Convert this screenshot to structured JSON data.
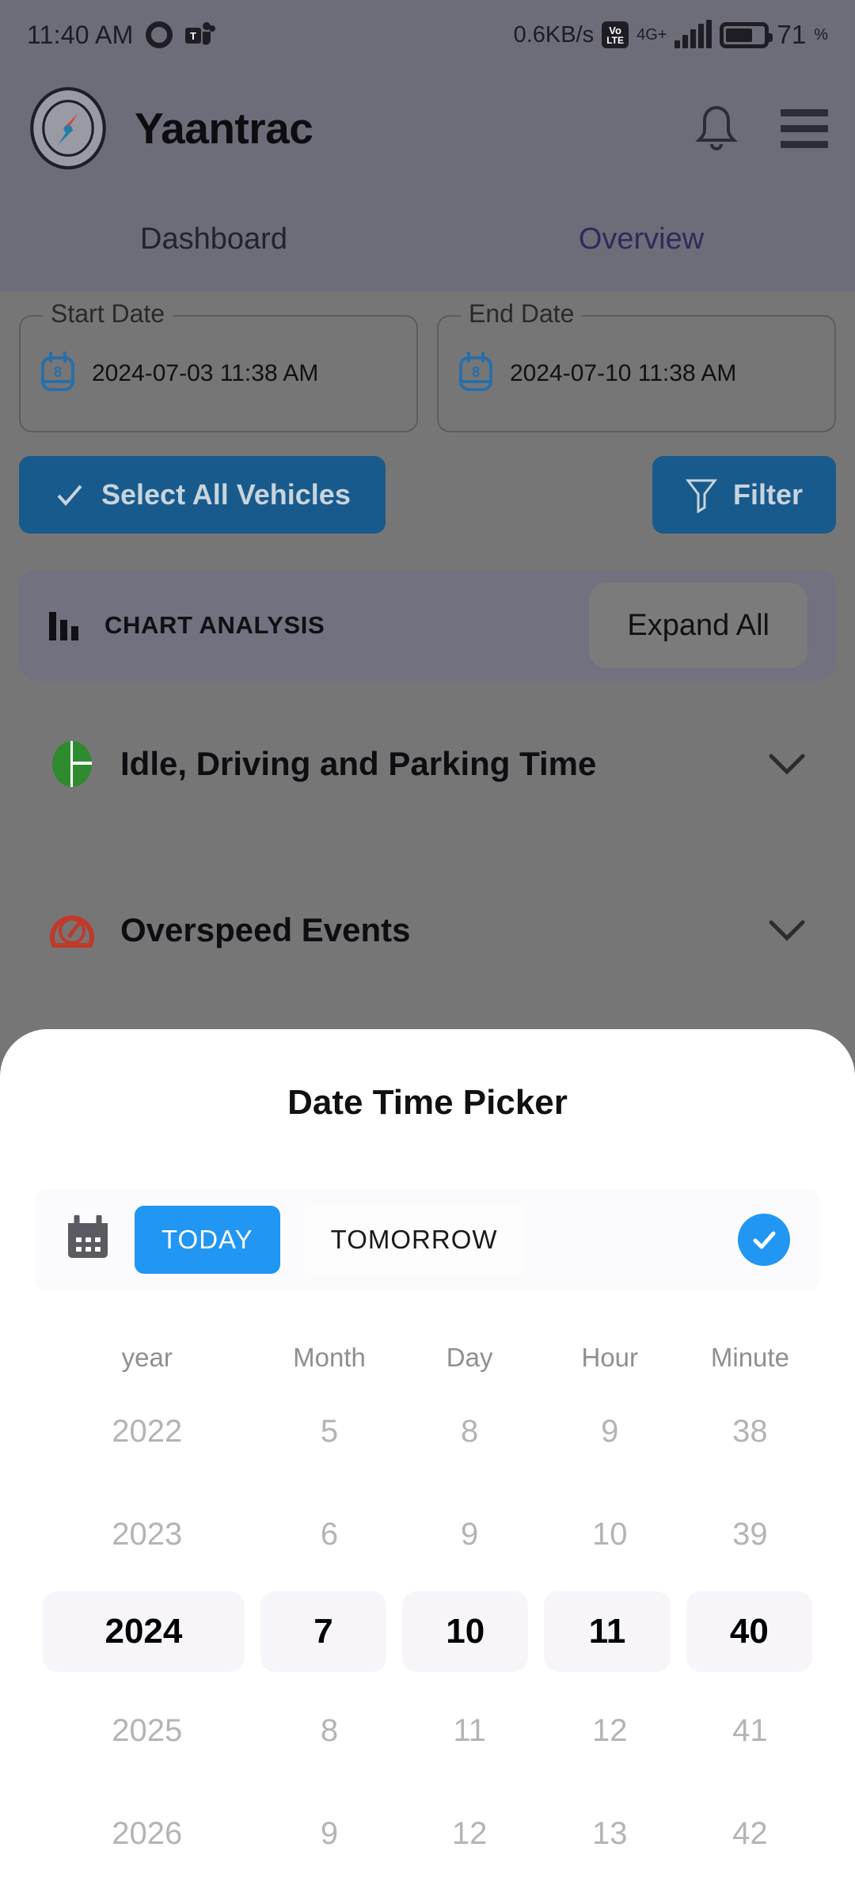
{
  "status_bar": {
    "time": "11:40 AM",
    "icons_left": [
      "screen-record-icon",
      "microsoft-teams-icon"
    ],
    "network_speed": "0.6KB/s",
    "volte_top": "Vo",
    "volte_bottom": "LTE",
    "network_generation": "4G+",
    "signal_icon": "signal-bars-icon",
    "battery_percent": "71",
    "battery_unit": "%"
  },
  "header": {
    "logo_icon": "compass-logo-icon",
    "app_title": "Yaantrac",
    "notification_icon": "bell-icon",
    "menu_icon": "hamburger-menu-icon"
  },
  "tabs": [
    {
      "label": "Dashboard",
      "active": false
    },
    {
      "label": "Overview",
      "active": true
    }
  ],
  "filters": {
    "start_date": {
      "legend": "Start Date",
      "value": "2024-07-03 11:38 AM",
      "icon": "calendar-icon"
    },
    "end_date": {
      "legend": "End Date",
      "value": "2024-07-10 11:38 AM",
      "icon": "calendar-icon"
    },
    "select_all_vehicles_label": "Select All Vehicles",
    "select_all_vehicles_icon": "check-icon",
    "filter_label": "Filter",
    "filter_icon": "funnel-icon"
  },
  "chart_analysis": {
    "icon": "bar-chart-icon",
    "label": "CHART ANALYSIS",
    "expand_all_label": "Expand All"
  },
  "accordions": [
    {
      "title": "Idle, Driving and Parking Time",
      "icon": "pie-chart-icon",
      "icon_color": "#2e8b2e",
      "chevron": "chevron-down-icon"
    },
    {
      "title": "Overspeed Events",
      "icon": "speedometer-icon",
      "icon_color": "#c0392b",
      "chevron": "chevron-down-icon"
    }
  ],
  "date_time_picker": {
    "title": "Date Time Picker",
    "calendar_icon": "calendar-icon",
    "quick_options": [
      {
        "label": "TODAY",
        "selected": true
      },
      {
        "label": "TOMORROW",
        "selected": false
      }
    ],
    "confirm_icon": "check-circle-icon",
    "columns": [
      "year",
      "Month",
      "Day",
      "Hour",
      "Minute"
    ],
    "rows": [
      {
        "values": [
          "2022",
          "5",
          "8",
          "9",
          "38"
        ],
        "selected": false
      },
      {
        "values": [
          "2023",
          "6",
          "9",
          "10",
          "39"
        ],
        "selected": false
      },
      {
        "values": [
          "2024",
          "7",
          "10",
          "11",
          "40"
        ],
        "selected": true
      },
      {
        "values": [
          "2025",
          "8",
          "11",
          "12",
          "41"
        ],
        "selected": false
      },
      {
        "values": [
          "2026",
          "9",
          "12",
          "13",
          "42"
        ],
        "selected": false
      }
    ],
    "selected_value": {
      "year": "2024",
      "month": "7",
      "day": "10",
      "hour": "11",
      "minute": "40"
    }
  },
  "colors": {
    "accent_blue": "#2196f3",
    "button_blue": "#195a8c",
    "overlay_header": "#6d6d7a",
    "overlay_body": "#767676",
    "sheet_background": "#ffffff",
    "selected_row_background": "#f7f5fa"
  }
}
